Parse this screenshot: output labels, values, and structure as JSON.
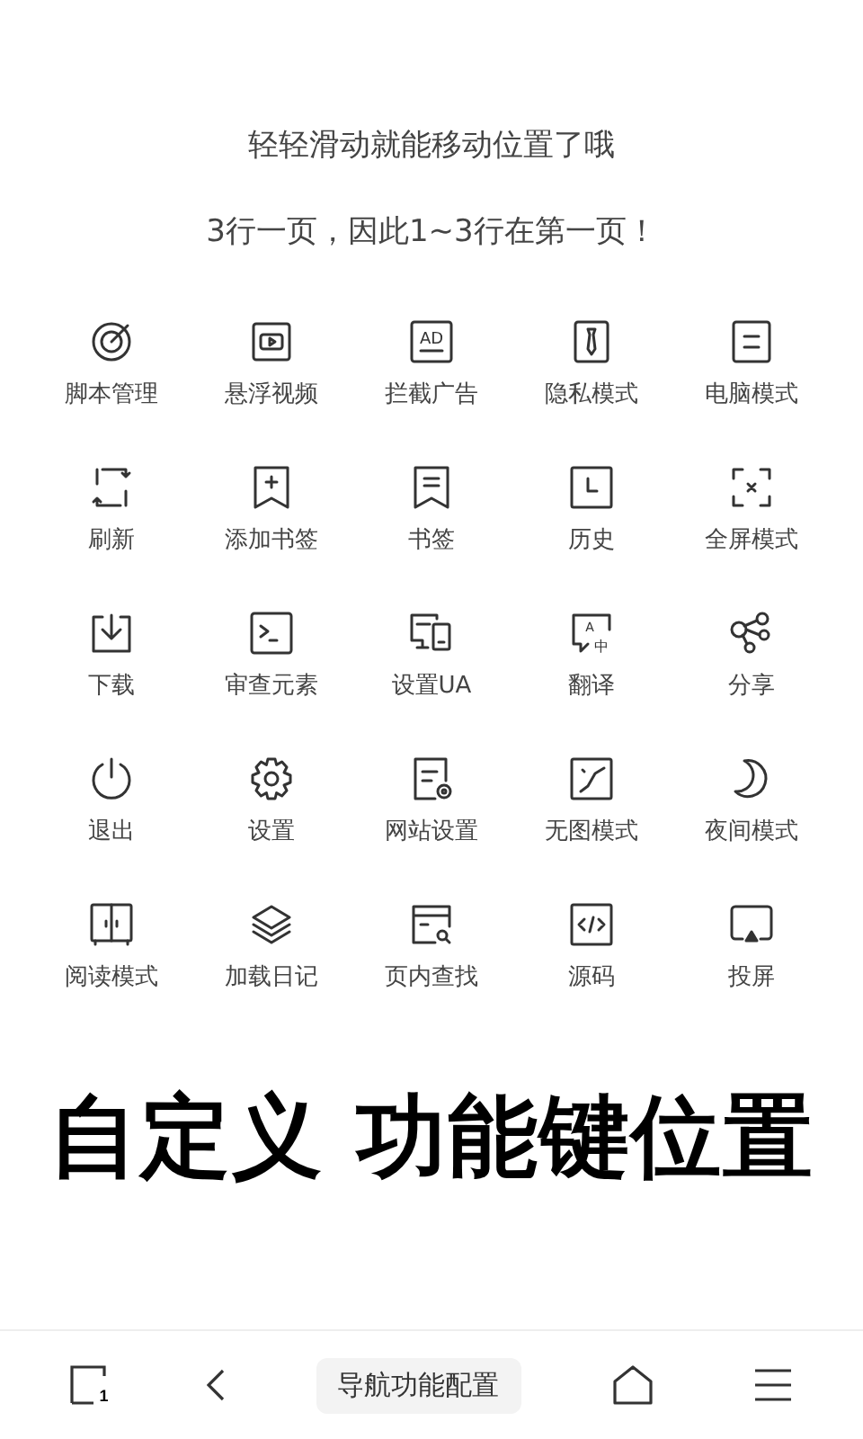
{
  "hints": [
    "轻轻滑动就能移动位置了哦",
    "3行一页，因此1~3行在第一页！"
  ],
  "features": [
    {
      "label": "脚本管理",
      "kind": "target"
    },
    {
      "label": "悬浮视频",
      "kind": "video"
    },
    {
      "label": "拦截广告",
      "kind": "ad",
      "icon_text": [
        "AD"
      ]
    },
    {
      "label": "隐私模式",
      "kind": "tie"
    },
    {
      "label": "电脑模式",
      "kind": "desktop"
    },
    {
      "label": "刷新",
      "kind": "refresh"
    },
    {
      "label": "添加书签",
      "kind": "bookmark-add"
    },
    {
      "label": "书签",
      "kind": "bookmark"
    },
    {
      "label": "历史",
      "kind": "history"
    },
    {
      "label": "全屏模式",
      "kind": "fullscreen"
    },
    {
      "label": "下载",
      "kind": "download"
    },
    {
      "label": "审查元素",
      "kind": "terminal"
    },
    {
      "label": "设置UA",
      "kind": "devices"
    },
    {
      "label": "翻译",
      "kind": "translate",
      "icon_text": [
        "A",
        "中"
      ]
    },
    {
      "label": "分享",
      "kind": "share"
    },
    {
      "label": "退出",
      "kind": "power"
    },
    {
      "label": "设置",
      "kind": "gear"
    },
    {
      "label": "网站设置",
      "kind": "site-settings"
    },
    {
      "label": "无图模式",
      "kind": "no-image"
    },
    {
      "label": "夜间模式",
      "kind": "moon"
    },
    {
      "label": "阅读模式",
      "kind": "cabinet"
    },
    {
      "label": "加载日记",
      "kind": "layers"
    },
    {
      "label": "页内查找",
      "kind": "find"
    },
    {
      "label": "源码",
      "kind": "code"
    },
    {
      "label": "投屏",
      "kind": "cast"
    }
  ],
  "headline": "自定义 功能键位置",
  "bottom_bar": [
    {
      "kind": "tabs",
      "count": "1"
    },
    {
      "kind": "back"
    },
    {
      "kind": "label",
      "label": "导航功能配置"
    },
    {
      "kind": "home"
    },
    {
      "kind": "menu"
    }
  ]
}
